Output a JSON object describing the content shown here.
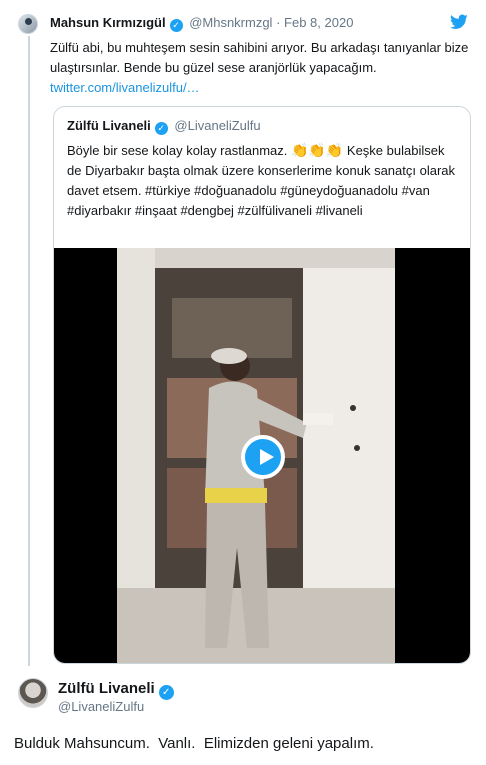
{
  "original_tweet": {
    "author_name": "Mahsun Kırmızıgül",
    "handle": "@Mhsnkrmzgl",
    "separator": "·",
    "date": "Feb 8, 2020",
    "text": "Zülfü abi, bu muhteşem sesin sahibini arıyor. Bu arkadaşı tanıyanlar bize ulaştırsınlar. Bende bu güzel sese  aranjörlük yapacağım.",
    "link": "twitter.com/livanelizulfu/…"
  },
  "quoted_tweet": {
    "author_name": "Zülfü Livaneli",
    "handle": "@LivaneliZulfu",
    "text_part1": "Böyle bir sese kolay kolay rastlanmaz.",
    "text_part2": " Keşke bulabilsek de Diyarbakır başta olmak üzere konserlerime konuk sanatçı olarak davet etsem. #türkiye #doğuanadolu #güneydoğuanadolu #van  #diyarbakır #inşaat #dengbej #zülfülivaneli #livaneli"
  },
  "reply": {
    "author_name": "Zülfü Livaneli",
    "handle": "@LivaneliZulfu",
    "text": "Bulduk Mahsuncum.  Vanlı.  Elimizden geleni yapalım."
  },
  "icons": {
    "verified": "verified-badge-icon",
    "twitter": "twitter-bird-icon",
    "play": "play-icon",
    "clap": "clapping-hands-icon"
  },
  "colors": {
    "twitter_blue": "#1da1f2",
    "link": "#1b95e0",
    "secondary_text": "#657786",
    "border": "#ccd6dd"
  }
}
